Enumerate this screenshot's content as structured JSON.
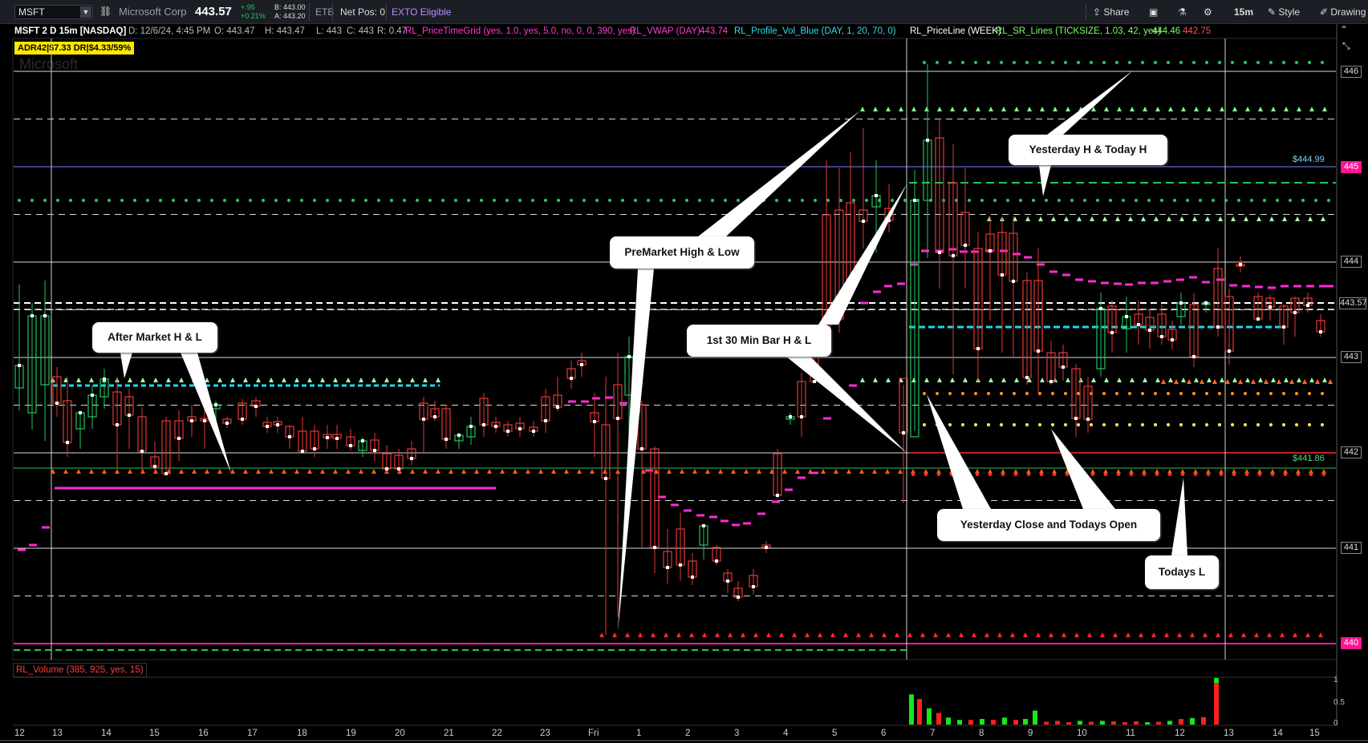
{
  "toolbar": {
    "symbol": "MSFT",
    "company": "Microsoft Corp",
    "last": "443.57",
    "change_abs": "+.95",
    "change_pct": "+0.21%",
    "bid": "B: 443.00",
    "ask": "A: 443.20",
    "etb": "ETB",
    "net_pos": "Net Pos: 0",
    "exto": "EXTO Eligible",
    "share": "Share",
    "timeframe": "15m",
    "style": "Style",
    "drawing": "Drawing"
  },
  "info": {
    "chart_name": "MSFT 2 D 15m [NASDAQ]",
    "date": "D: 12/6/24, 4:45 PM",
    "open": "O: 443.47",
    "high": "H: 443.47",
    "low": "L: 443",
    "close": "C: 443",
    "range": "R: 0.47",
    "study1": "RL_PriceTimeGrid (yes, 1.0, yes, 5.0, no, 0, 0, 390, yes)",
    "study2": "RL_VWAP (DAY)",
    "study2_val": "443.74",
    "study3": "RL_Profile_Vol_Blue (DAY, 1, 20, 70, 0)",
    "study4": "RL_PriceLine (WEEK)",
    "study5": "RL_SR_Lines (TICKSIZE, 1.03, 42, yes)",
    "study5_val1": "444.46",
    "study5_val2": "442.75",
    "adr": "ADR42|$7.33  DR|$4.33/59%",
    "watermark": "Microsoft"
  },
  "callouts": {
    "after_market": "After Market H & L",
    "premarket": "PreMarket High & Low",
    "first30": "1st 30 Min Bar H & L",
    "yesterday_today_high": "Yesterday H & Today H",
    "yesterday_close": "Yesterday Close and Todays Open",
    "todays_low": "Todays L"
  },
  "price_axis": {
    "labels": [
      "446",
      "445",
      "444",
      "443.57",
      "443",
      "442",
      "441",
      "440"
    ],
    "level_444_99": "$444.99",
    "level_441_86": "$441.86"
  },
  "volume": {
    "title": "RL_Volume (385, 925, yes, 15)",
    "ticks": [
      "1",
      "0.5",
      "0"
    ]
  },
  "time_axis": [
    "12",
    "13",
    "14",
    "15",
    "16",
    "17",
    "18",
    "19",
    "20",
    "21",
    "22",
    "23",
    "Fri",
    "1",
    "2",
    "3",
    "4",
    "5",
    "6",
    "7",
    "8",
    "9",
    "10",
    "11",
    "12",
    "13",
    "14",
    "15"
  ],
  "colors": {
    "bull": "#22c55e",
    "bear": "#e53935",
    "vwap": "#ff2bd6",
    "profile": "#20d6ea",
    "bg": "#000000"
  }
}
